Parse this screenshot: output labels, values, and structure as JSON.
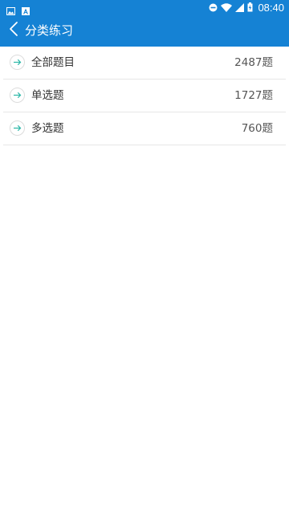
{
  "status_bar": {
    "time": "08:40",
    "left_icons": [
      "image-icon",
      "font-icon"
    ],
    "right_icons": [
      "do-not-disturb-icon",
      "wifi-icon",
      "signal-icon",
      "battery-charging-icon"
    ]
  },
  "app_bar": {
    "title": "分类练习",
    "back_icon": "chevron-left-icon"
  },
  "list": {
    "items": [
      {
        "label": "全部题目",
        "count": "2487题",
        "icon": "arrow-right-icon"
      },
      {
        "label": "单选题",
        "count": "1727题",
        "icon": "arrow-right-icon"
      },
      {
        "label": "多选题",
        "count": "760题",
        "icon": "arrow-right-icon"
      }
    ]
  },
  "colors": {
    "primary": "#1582d4",
    "accent": "#29b6a6",
    "divider": "#e6e6e6",
    "text": "#333333"
  }
}
